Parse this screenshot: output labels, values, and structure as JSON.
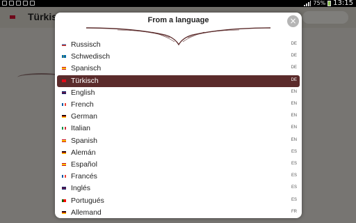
{
  "status_bar": {
    "battery": "75%",
    "time": "13:15"
  },
  "background_app": {
    "title": "Türkisch"
  },
  "dialog": {
    "title": "From a language",
    "close_icon": "close-icon"
  },
  "colors": {
    "selected_row": "#5b2b2b",
    "ornament": "#5b2b2b"
  },
  "languages": [
    {
      "name": "Russisch",
      "code": "DE",
      "flag": "russia-flag-icon",
      "selected": false
    },
    {
      "name": "Schwedisch",
      "code": "DE",
      "flag": "sweden-flag-icon",
      "selected": false
    },
    {
      "name": "Spanisch",
      "code": "DE",
      "flag": "spain-flag-icon",
      "selected": false
    },
    {
      "name": "Türkisch",
      "code": "DE",
      "flag": "turkey-flag-icon",
      "selected": true
    },
    {
      "name": "English",
      "code": "EN",
      "flag": "uk-flag-icon",
      "selected": false
    },
    {
      "name": "French",
      "code": "EN",
      "flag": "france-flag-icon",
      "selected": false
    },
    {
      "name": "German",
      "code": "EN",
      "flag": "germany-flag-icon",
      "selected": false
    },
    {
      "name": "Italian",
      "code": "EN",
      "flag": "italy-flag-icon",
      "selected": false
    },
    {
      "name": "Spanish",
      "code": "EN",
      "flag": "spain-flag-icon",
      "selected": false
    },
    {
      "name": "Alemán",
      "code": "ES",
      "flag": "germany-flag-icon",
      "selected": false
    },
    {
      "name": "Español",
      "code": "ES",
      "flag": "spain-flag-icon",
      "selected": false
    },
    {
      "name": "Francés",
      "code": "ES",
      "flag": "france-flag-icon",
      "selected": false
    },
    {
      "name": "Inglés",
      "code": "ES",
      "flag": "uk-flag-icon",
      "selected": false
    },
    {
      "name": "Portugués",
      "code": "ES",
      "flag": "portugal-flag-icon",
      "selected": false
    },
    {
      "name": "Allemand",
      "code": "FR",
      "flag": "germany-flag-icon",
      "selected": false
    }
  ]
}
